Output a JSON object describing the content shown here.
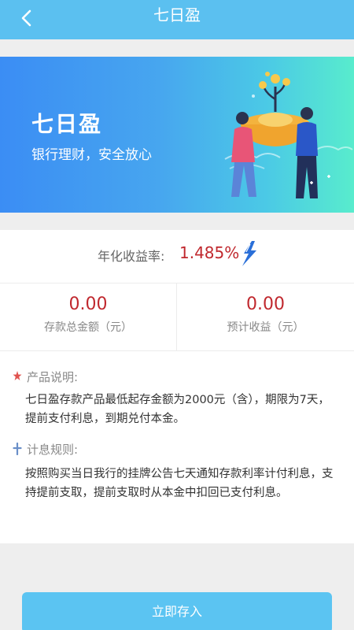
{
  "nav": {
    "title": "七日盈",
    "back_icon": "chevron-left-icon"
  },
  "banner": {
    "title": "七日盈",
    "subtitle": "银行理财，安全放心",
    "gradient": [
      "#3b8df4",
      "#58eccd"
    ]
  },
  "rate": {
    "label": "年化收益率:",
    "value": "1.485%",
    "icon": "lightning-bolt-icon"
  },
  "stats": [
    {
      "value": "0.00",
      "label": "存款总金额（元）"
    },
    {
      "value": "0.00",
      "label": "预计收益（元）"
    }
  ],
  "product_desc": {
    "title": "产品说明:",
    "icon": "star-bullet-icon",
    "text": "七日盈存款产品最低起存金额为2000元（含），期限为7天，提前支付利息，到期兑付本金。"
  },
  "interest_rules": {
    "title": "计息规则:",
    "icon": "plus-bullet-icon",
    "text": "按照购买当日我行的挂牌公告七天通知存款利率计付利息，支持提前支取，提前支取时从本金中扣回已支付利息。"
  },
  "deposit_button": {
    "label": "立即存入"
  },
  "colors": {
    "accent": "#5bc0f0",
    "value_red": "#c0282e"
  }
}
